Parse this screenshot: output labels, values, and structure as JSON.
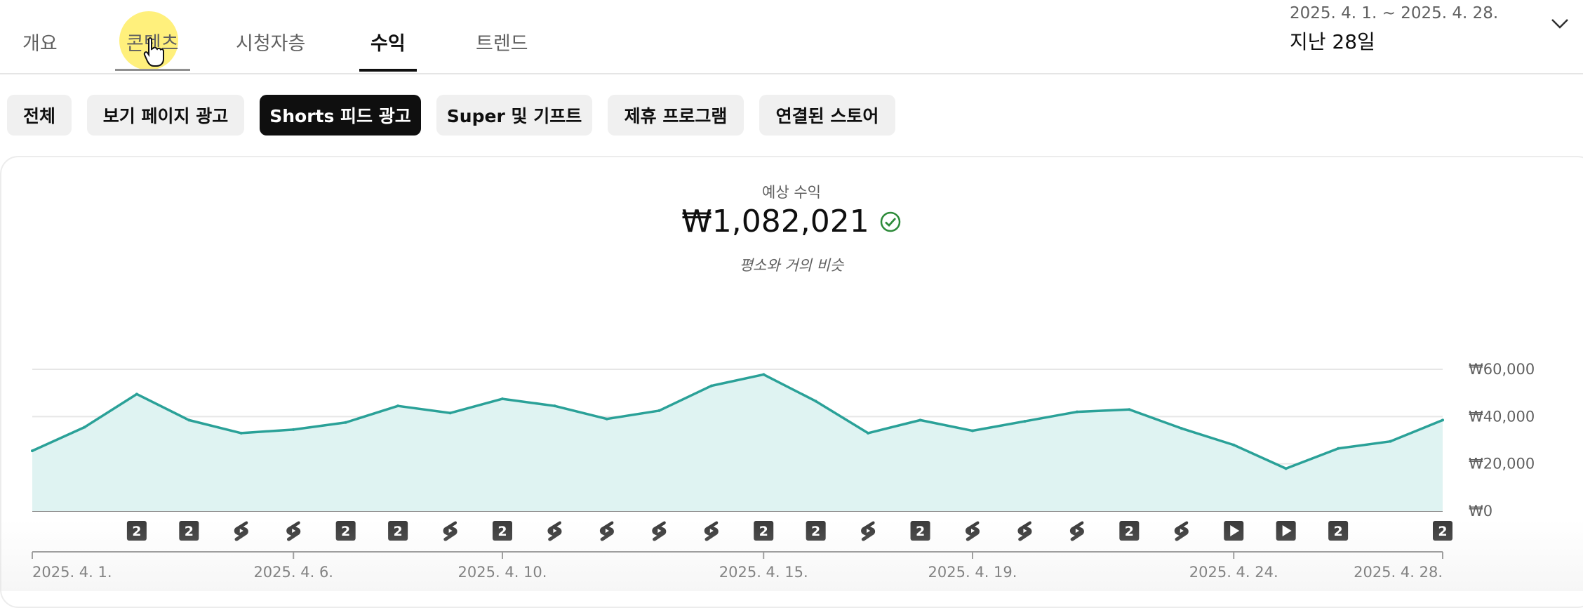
{
  "tabs": [
    {
      "label": "개요",
      "active": false
    },
    {
      "label": "콘텐츠",
      "active": false,
      "hovered": true
    },
    {
      "label": "시청자층",
      "active": false
    },
    {
      "label": "수익",
      "active": true
    },
    {
      "label": "트렌드",
      "active": false
    }
  ],
  "date_picker": {
    "range": "2025. 4. 1. ~ 2025. 4. 28.",
    "preset": "지난 28일"
  },
  "chips": [
    {
      "label": "전체",
      "active": false
    },
    {
      "label": "보기 페이지 광고",
      "active": false
    },
    {
      "label": "Shorts 피드 광고",
      "active": true
    },
    {
      "label": "Super 및 기프트",
      "active": false
    },
    {
      "label": "제휴 프로그램",
      "active": false
    },
    {
      "label": "연결된 스토어",
      "active": false
    }
  ],
  "metric": {
    "label": "예상 수익",
    "value": "₩1,082,021",
    "comparison": "평소와 거의 비슷"
  },
  "chart_data": {
    "type": "area",
    "x": [
      "2025-04-01",
      "2025-04-02",
      "2025-04-03",
      "2025-04-04",
      "2025-04-05",
      "2025-04-06",
      "2025-04-07",
      "2025-04-08",
      "2025-04-09",
      "2025-04-10",
      "2025-04-11",
      "2025-04-12",
      "2025-04-13",
      "2025-04-14",
      "2025-04-15",
      "2025-04-16",
      "2025-04-17",
      "2025-04-18",
      "2025-04-19",
      "2025-04-20",
      "2025-04-21",
      "2025-04-22",
      "2025-04-23",
      "2025-04-24",
      "2025-04-25",
      "2025-04-26",
      "2025-04-27",
      "2025-04-28"
    ],
    "values": [
      25500,
      35500,
      49500,
      38500,
      33000,
      34500,
      37500,
      44500,
      41500,
      47500,
      44500,
      39000,
      42500,
      53000,
      57800,
      46500,
      33000,
      38500,
      34000,
      38000,
      42000,
      43000,
      35000,
      28000,
      18000,
      26500,
      29500,
      38500
    ],
    "ylim": [
      0,
      60000
    ],
    "y_ticks": [
      "₩0",
      "₩20,000",
      "₩40,000",
      "₩60,000"
    ],
    "y_tick_values": [
      0,
      20000,
      40000,
      60000
    ],
    "x_tick_labels": [
      {
        "index": 0,
        "label": "2025. 4. 1."
      },
      {
        "index": 5,
        "label": "2025. 4. 6."
      },
      {
        "index": 9,
        "label": "2025. 4. 10."
      },
      {
        "index": 14,
        "label": "2025. 4. 15."
      },
      {
        "index": 18,
        "label": "2025. 4. 19."
      },
      {
        "index": 23,
        "label": "2025. 4. 24."
      },
      {
        "index": 27,
        "label": "2025. 4. 28."
      }
    ],
    "markers": [
      {
        "index": 2,
        "type": "badge",
        "label": "2"
      },
      {
        "index": 3,
        "type": "badge",
        "label": "2"
      },
      {
        "index": 4,
        "type": "shorts"
      },
      {
        "index": 5,
        "type": "shorts"
      },
      {
        "index": 6,
        "type": "badge",
        "label": "2"
      },
      {
        "index": 7,
        "type": "badge",
        "label": "2"
      },
      {
        "index": 8,
        "type": "shorts"
      },
      {
        "index": 9,
        "type": "badge",
        "label": "2"
      },
      {
        "index": 10,
        "type": "shorts"
      },
      {
        "index": 11,
        "type": "shorts"
      },
      {
        "index": 12,
        "type": "shorts"
      },
      {
        "index": 13,
        "type": "shorts"
      },
      {
        "index": 14,
        "type": "badge",
        "label": "2"
      },
      {
        "index": 15,
        "type": "badge",
        "label": "2"
      },
      {
        "index": 16,
        "type": "shorts"
      },
      {
        "index": 17,
        "type": "badge",
        "label": "2"
      },
      {
        "index": 18,
        "type": "shorts"
      },
      {
        "index": 19,
        "type": "shorts"
      },
      {
        "index": 20,
        "type": "shorts"
      },
      {
        "index": 21,
        "type": "badge",
        "label": "2"
      },
      {
        "index": 22,
        "type": "shorts"
      },
      {
        "index": 23,
        "type": "play"
      },
      {
        "index": 24,
        "type": "play"
      },
      {
        "index": 25,
        "type": "badge",
        "label": "2"
      },
      {
        "index": 27,
        "type": "badge",
        "label": "2"
      }
    ],
    "grid": true,
    "colors": {
      "line": "#2aa198",
      "fill": "#dff3f2",
      "grid": "#e6e6e6",
      "axis": "#909090"
    }
  }
}
